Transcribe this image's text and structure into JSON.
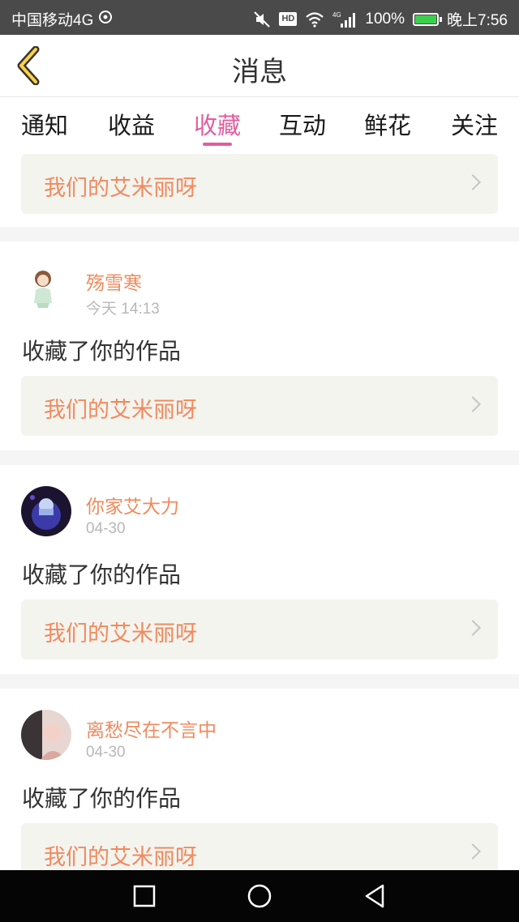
{
  "status_bar": {
    "carrier": "中国移动4G",
    "battery": "100%",
    "time": "晚上7:56",
    "icons": [
      "sync-icon",
      "mute-icon",
      "hd-icon",
      "wifi-icon",
      "signal-icon",
      "battery-icon"
    ]
  },
  "header": {
    "title": "消息",
    "back_icon": "chevron-left-icon"
  },
  "tabs": [
    {
      "label": "通知",
      "active": false
    },
    {
      "label": "收益",
      "active": false
    },
    {
      "label": "收藏",
      "active": true
    },
    {
      "label": "互动",
      "active": false
    },
    {
      "label": "鲜花",
      "active": false
    },
    {
      "label": "关注",
      "active": false
    }
  ],
  "messages": [
    {
      "work_title": "我们的艾米丽呀"
    },
    {
      "username": "殇雪寒",
      "time": "今天 14:13",
      "action": "收藏了你的作品",
      "work_title": "我们的艾米丽呀"
    },
    {
      "username": "你家艾大力",
      "time": "04-30",
      "action": "收藏了你的作品",
      "work_title": "我们的艾米丽呀"
    },
    {
      "username": "离愁尽在不言中",
      "time": "04-30",
      "action": "收藏了你的作品",
      "work_title": "我们的艾米丽呀"
    }
  ],
  "nav_bar": {
    "icons": [
      "recent-apps-icon",
      "home-icon",
      "back-triangle-icon"
    ]
  },
  "colors": {
    "accent": "#e35d9e",
    "username": "#f08a5d",
    "status_bar": "#4a4a4a"
  }
}
